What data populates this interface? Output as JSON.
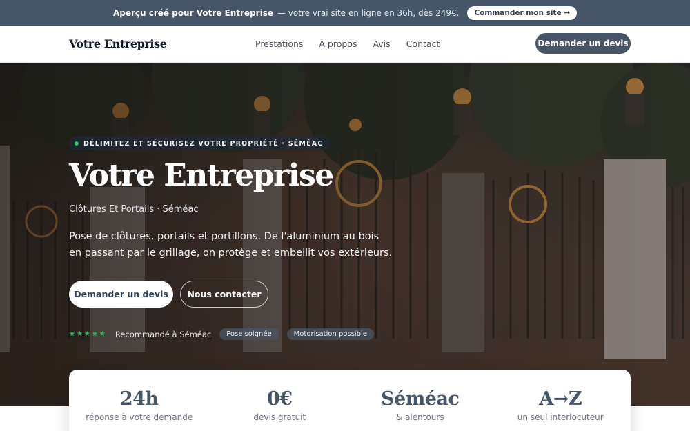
{
  "banner": {
    "strong": "Aperçu créé pour Votre Entreprise",
    "text": "— votre vrai site en ligne en 36h, dès 249€.",
    "button": "Commander mon site →"
  },
  "nav": {
    "brand": "Votre Entreprise",
    "items": [
      {
        "label": "Prestations"
      },
      {
        "label": "À propos"
      },
      {
        "label": "Avis"
      },
      {
        "label": "Contact"
      }
    ],
    "cta": "Demander un devis"
  },
  "hero": {
    "eyebrow": "DÉLIMITEZ ET SÉCURISEZ VOTRE PROPRIÉTÉ · SÉMÉAC",
    "title": "Votre Entreprise",
    "subtitle": "Clôtures Et Portails · Séméac",
    "description": "Pose de clôtures, portails et portillons. De l'aluminium au bois en passant par le grillage, on protège et embellit vos extérieurs.",
    "primary_button": "Demander un devis",
    "secondary_button": "Nous contacter",
    "rating_stars": "★★★★★",
    "trust_text": "Recommandé à Séméac",
    "chips": [
      "Pose soignée",
      "Motorisation possible"
    ]
  },
  "stats": [
    {
      "value": "24h",
      "label": "réponse à votre demande"
    },
    {
      "value": "0€",
      "label": "devis gratuit"
    },
    {
      "value": "Séméac",
      "label": "& alentours"
    },
    {
      "value": "A→Z",
      "label": "un seul interlocuteur"
    }
  ],
  "colors": {
    "accent": "#475569",
    "star": "#22c55e"
  }
}
